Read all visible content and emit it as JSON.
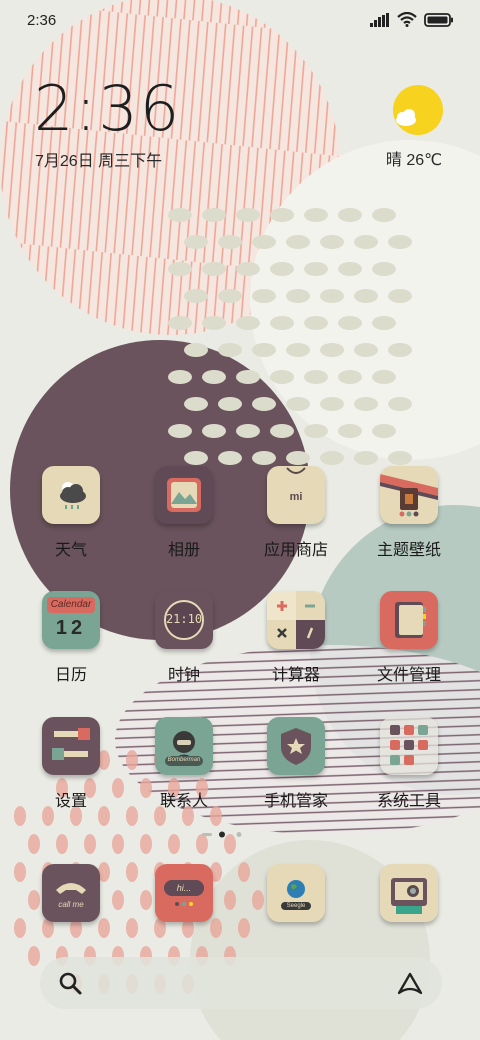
{
  "status_bar": {
    "time": "2:36"
  },
  "clock_widget": {
    "time": "2:36",
    "date": "7月26日 周三下午"
  },
  "weather_widget": {
    "text": "晴 26℃"
  },
  "apps": [
    {
      "label": "天气",
      "icon": "weather-icon"
    },
    {
      "label": "相册",
      "icon": "gallery-icon"
    },
    {
      "label": "应用商店",
      "icon": "app-store-icon"
    },
    {
      "label": "主题壁纸",
      "icon": "themes-icon"
    },
    {
      "label": "日历",
      "icon": "calendar-icon",
      "badge_text": "Calendar",
      "day": "12"
    },
    {
      "label": "时钟",
      "icon": "clock-icon",
      "face_text": "21:10"
    },
    {
      "label": "计算器",
      "icon": "calculator-icon"
    },
    {
      "label": "文件管理",
      "icon": "file-manager-icon"
    },
    {
      "label": "设置",
      "icon": "settings-icon"
    },
    {
      "label": "联系人",
      "icon": "contacts-icon",
      "badge_text": "Bomberman"
    },
    {
      "label": "手机管家",
      "icon": "security-icon"
    },
    {
      "label": "系统工具",
      "icon": "system-tools-folder-icon"
    }
  ],
  "dock": [
    {
      "icon": "phone-icon",
      "text": "call me"
    },
    {
      "icon": "messages-icon",
      "text": "hi..."
    },
    {
      "icon": "browser-icon",
      "text": "Seegle"
    },
    {
      "icon": "camera-icon"
    }
  ],
  "pager": {
    "pages": 3,
    "current": 2
  },
  "colors": {
    "mauve": "#6c525c",
    "sage": "#7aa594",
    "coral": "#d9625a",
    "cream": "#e4d8b8",
    "sun": "#f7d21f"
  }
}
